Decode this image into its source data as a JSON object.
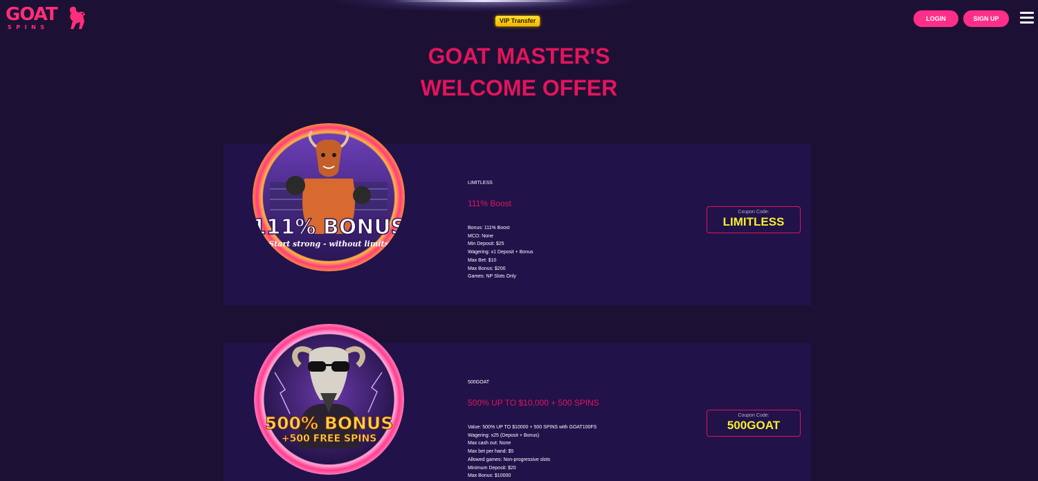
{
  "header": {
    "logo_text": "GOAT",
    "logo_subtext": "SPINS",
    "vip_label": "VIP Transfer",
    "login_label": "LOGIN",
    "signup_label": "SIGN UP",
    "menu_icon": "hamburger-menu-icon"
  },
  "page": {
    "title_line1": "GOAT MASTER'S",
    "title_line2": "WELCOME OFFER"
  },
  "promos": [
    {
      "image_text_main": "111% BONUS",
      "image_text_sub": "Start strong - without limits",
      "code": "LIMITLESS",
      "title": "111% Boost",
      "details": [
        "Bonus: 111% Boost",
        "MCO: None",
        "Min Deposit: $25",
        "Wagering: x1 Deposit + Bonus",
        "Max Bet: $10",
        "Max Bonus: $200",
        "Games: NP Slots Only"
      ],
      "coupon_label": "Coupon Code:",
      "coupon_value": "LIMITLESS"
    },
    {
      "image_text_main": "500% BONUS",
      "image_text_sub": "+500 FREE SPINS",
      "code": "500GOAT",
      "title": "500% UP TO $10,000 + 500 SPINS",
      "details": [
        "Value: 500% UP TO $10000 + 500 SPINS with GOAT100FS",
        "Wagering: x25 (Deposit + Bonus)",
        "Max cash out: None",
        "Max bet per hand: $5",
        "Allowed games: Non-progressive slots",
        "Minimum Deposit: $20",
        "Max Bonus: $10000"
      ],
      "coupon_label": "Coupon Code:",
      "coupon_value": "500GOAT"
    }
  ],
  "colors": {
    "background": "#1c1134",
    "card": "#21124a",
    "accent_pink": "#ff2f89",
    "title_red": "#e3145c",
    "coupon_yellow": "#f6ef2a",
    "vip_gold": "#ffd21a"
  }
}
